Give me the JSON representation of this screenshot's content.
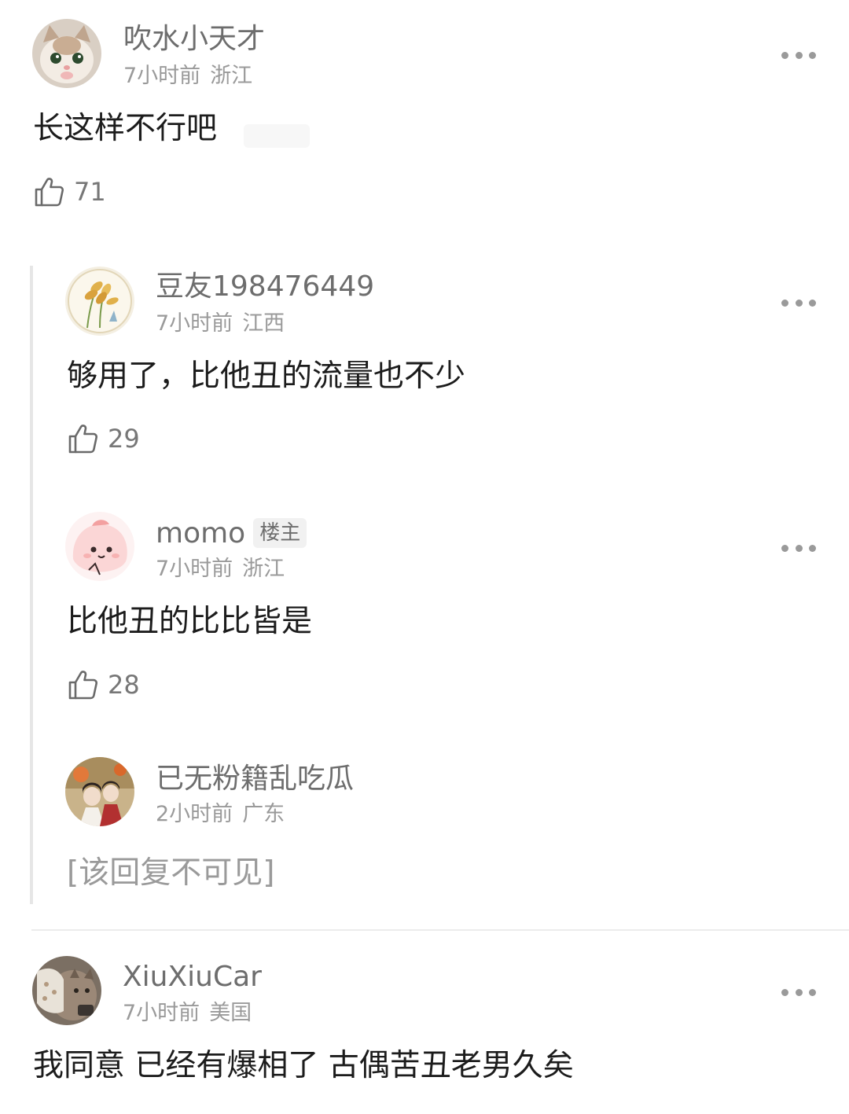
{
  "comments": [
    {
      "username": "吹水小天才",
      "time": "7小时前",
      "location": "浙江",
      "text": "长这样不行吧",
      "likes": "71"
    },
    {
      "username": "XiuXiuCar",
      "time": "7小时前",
      "location": "美国",
      "text": "我同意 已经有爆相了 古偶苦丑老男久矣"
    }
  ],
  "replies": [
    {
      "username": "豆友198476449",
      "time": "7小时前",
      "location": "江西",
      "text": "够用了，比他丑的流量也不少",
      "likes": "29"
    },
    {
      "username": "momo",
      "badge": "楼主",
      "time": "7小时前",
      "location": "浙江",
      "text": "比他丑的比比皆是",
      "likes": "28"
    },
    {
      "username": "已无粉籍乱吃瓜",
      "time": "2小时前",
      "location": "广东",
      "text": "[该回复不可见]"
    }
  ],
  "icons": {
    "like": "thumbs-up-icon",
    "more": "more-dots-icon"
  },
  "colors": {
    "username": "#6d6d6d",
    "meta": "#9a9a9a",
    "text": "#1c1c1c",
    "thread_line": "#e6e6e6"
  }
}
